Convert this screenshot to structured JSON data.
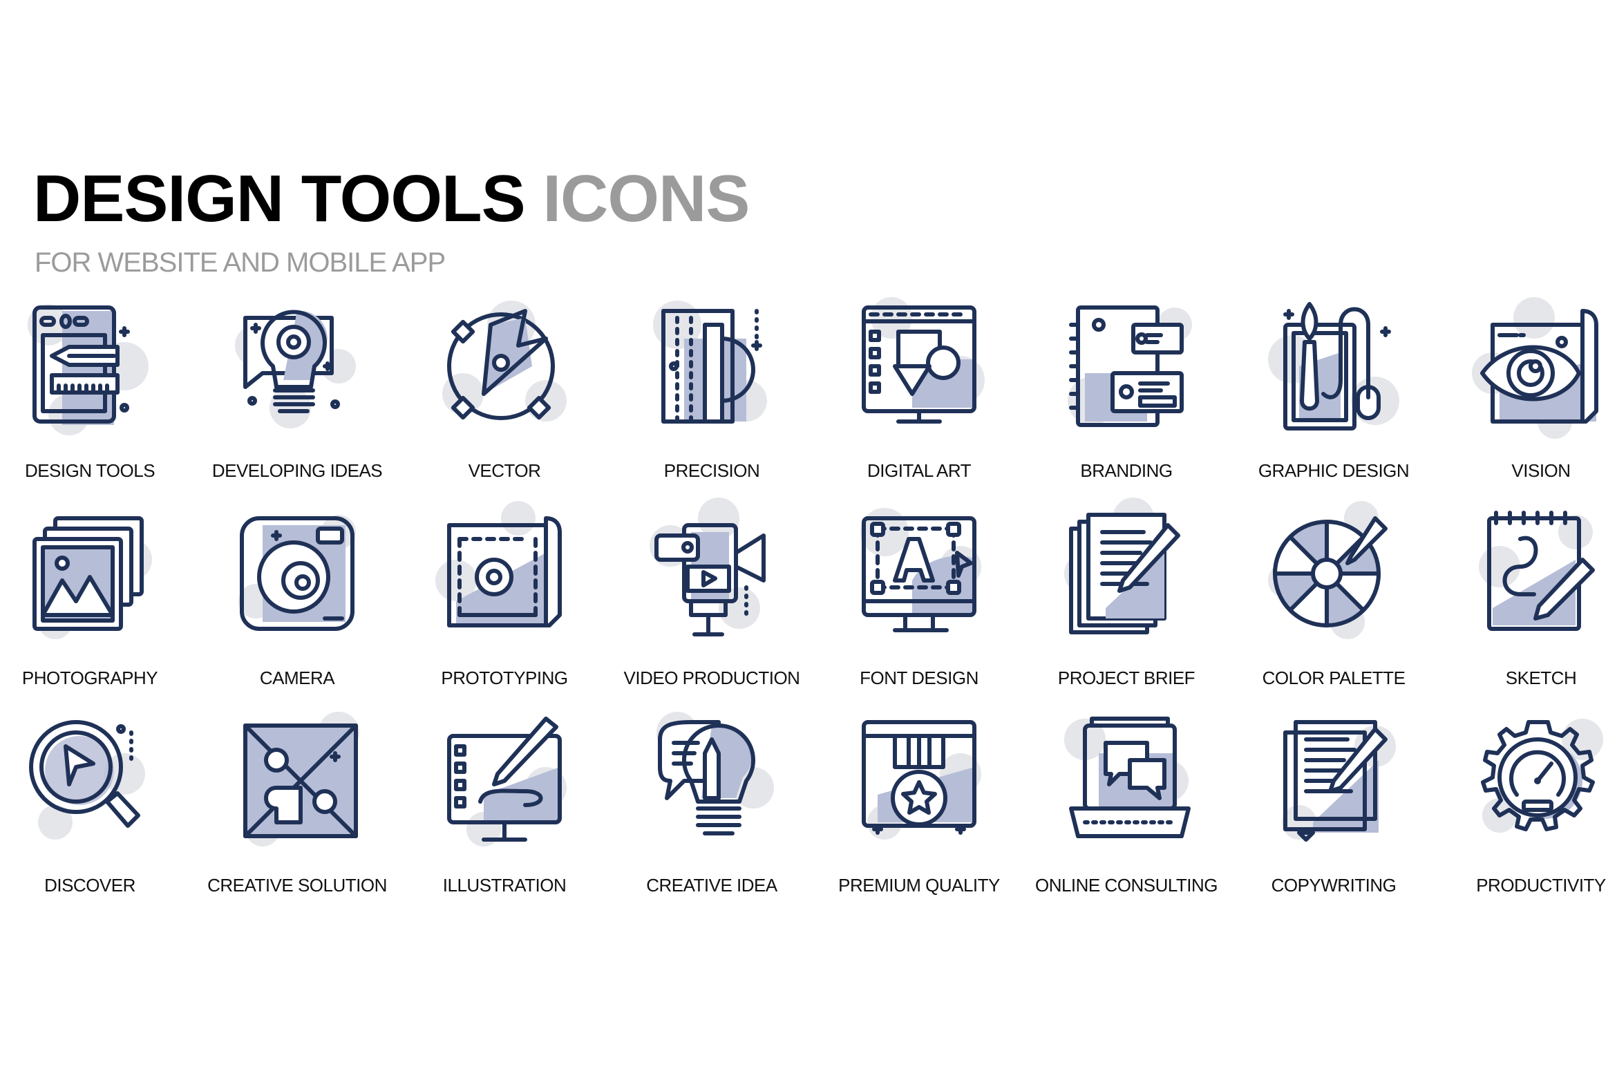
{
  "header": {
    "title_dark": "DESIGN TOOLS",
    "title_light": "ICONS",
    "subtitle": "FOR WEBSITE AND MOBILE APP"
  },
  "colors": {
    "stroke": "#1f3157",
    "fill": "#b6bdd6",
    "blob": "#e5e6ea",
    "title_dark": "#000000",
    "title_light": "#9b9b9b"
  },
  "icons": [
    {
      "label": "DESIGN TOOLS",
      "icon": "design-tools-icon"
    },
    {
      "label": "DEVELOPING IDEAS",
      "icon": "developing-ideas-icon"
    },
    {
      "label": "VECTOR",
      "icon": "vector-icon"
    },
    {
      "label": "PRECISION",
      "icon": "precision-icon"
    },
    {
      "label": "DIGITAL ART",
      "icon": "digital-art-icon"
    },
    {
      "label": "BRANDING",
      "icon": "branding-icon"
    },
    {
      "label": "GRAPHIC DESIGN",
      "icon": "graphic-design-icon"
    },
    {
      "label": "VISION",
      "icon": "vision-icon"
    },
    {
      "label": "PHOTOGRAPHY",
      "icon": "photography-icon"
    },
    {
      "label": "CAMERA",
      "icon": "camera-icon"
    },
    {
      "label": "PROTOTYPING",
      "icon": "prototyping-icon"
    },
    {
      "label": "VIDEO PRODUCTION",
      "icon": "video-production-icon"
    },
    {
      "label": "FONT DESIGN",
      "icon": "font-design-icon"
    },
    {
      "label": "PROJECT BRIEF",
      "icon": "project-brief-icon"
    },
    {
      "label": "COLOR PALETTE",
      "icon": "color-palette-icon"
    },
    {
      "label": "SKETCH",
      "icon": "sketch-icon"
    },
    {
      "label": "DISCOVER",
      "icon": "discover-icon"
    },
    {
      "label": "CREATIVE SOLUTION",
      "icon": "creative-solution-icon"
    },
    {
      "label": "ILLUSTRATION",
      "icon": "illustration-icon"
    },
    {
      "label": "CREATIVE IDEA",
      "icon": "creative-idea-icon"
    },
    {
      "label": "PREMIUM QUALITY",
      "icon": "premium-quality-icon"
    },
    {
      "label": "ONLINE CONSULTING",
      "icon": "online-consulting-icon"
    },
    {
      "label": "COPYWRITING",
      "icon": "copywriting-icon"
    },
    {
      "label": "PRODUCTIVITY",
      "icon": "productivity-icon"
    }
  ]
}
